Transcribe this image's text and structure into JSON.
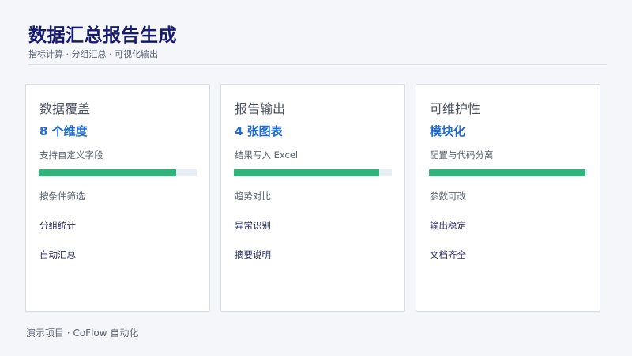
{
  "header": {
    "title": "数据汇总报告生成",
    "subtitle": "指标计算 · 分组汇总 · 可视化输出"
  },
  "cards": [
    {
      "title": "数据覆盖",
      "metric": "8 个维度",
      "desc": "支持自定义字段",
      "progress": 0.87,
      "items": [
        "按条件筛选",
        "分组统计",
        "自动汇总"
      ]
    },
    {
      "title": "报告输出",
      "metric": "4 张图表",
      "desc": "结果写入 Excel",
      "progress": 0.92,
      "items": [
        "趋势对比",
        "异常识别",
        "摘要说明"
      ]
    },
    {
      "title": "可维护性",
      "metric": "模块化",
      "desc": "配置与代码分离",
      "progress": 0.99,
      "items": [
        "参数可改",
        "输出稳定",
        "文档齐全"
      ]
    }
  ],
  "footer": {
    "text": "演示项目 · CoFlow 自动化"
  },
  "colors": {
    "title": "#161a6e",
    "metric": "#1f6bd8",
    "progress_fill": "#2fb57c",
    "progress_track": "#e6edf5",
    "background": "#f4f6fa"
  }
}
